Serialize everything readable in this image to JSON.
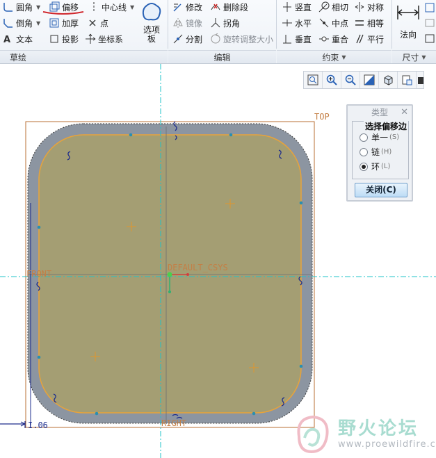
{
  "ribbon": {
    "sketch": {
      "fillet": "圆角",
      "offset": "偏移",
      "centerline": "中心线",
      "chamfer": "倒角",
      "thicken": "加厚",
      "point": "点",
      "text": "文本",
      "project": "投影",
      "csys": "坐标系",
      "palette_line1": "选项",
      "palette_line2": "板",
      "group_label": "草绘"
    },
    "edit": {
      "modify": "修改",
      "delete_segment": "删除段",
      "mirror": "镜像",
      "corner": "拐角",
      "divide": "分割",
      "rotate_resize": "旋转调整大小",
      "group_label": "编辑"
    },
    "constrain": {
      "vertical": "竖直",
      "tangent": "相切",
      "symmetric": "对称",
      "horizontal": "水平",
      "midpoint": "中点",
      "equal": "相等",
      "perpendicular": "垂直",
      "coincident": "重合",
      "parallel": "平行",
      "group_label": "约束"
    },
    "dimension": {
      "normal": "法向",
      "group_label": "尺寸"
    }
  },
  "canvas": {
    "labels": {
      "top": "TOP",
      "front": "FRONT",
      "right": "RIGHT",
      "csys": "DEFAULT_CSYS"
    },
    "colors": {
      "fill": "#a49e73",
      "offset_band": "#8c95a1",
      "sketch": "#e8a33a",
      "datum": "#1fc3c8",
      "datum_plane": "#b86f33"
    }
  },
  "dialog": {
    "title": "类型",
    "group": "选择偏移边",
    "options": [
      {
        "label": "单一",
        "key": "(S)",
        "selected": false
      },
      {
        "label": "链",
        "key": "(H)",
        "selected": false
      },
      {
        "label": "环",
        "key": "(L)",
        "selected": true
      }
    ],
    "close_button": "关闭(C)"
  },
  "watermark": {
    "name": "野火论坛",
    "url": "www.proewildfire.cn"
  }
}
